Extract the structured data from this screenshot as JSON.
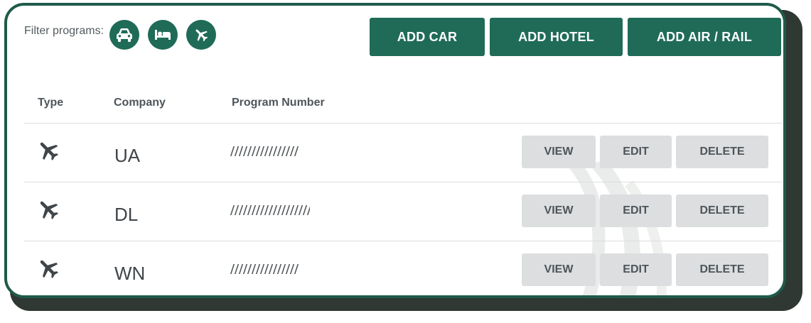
{
  "filter": {
    "label": "Filter programs:",
    "buttons": [
      {
        "icon": "car-icon",
        "name": "filter-car-button"
      },
      {
        "icon": "bed-icon",
        "name": "filter-hotel-button"
      },
      {
        "icon": "plane-icon",
        "name": "filter-air-button"
      }
    ]
  },
  "actions": {
    "add_car": "ADD CAR",
    "add_hotel": "ADD HOTEL",
    "add_air_rail": "ADD AIR / RAIL"
  },
  "table": {
    "headers": {
      "type": "Type",
      "company": "Company",
      "program_number": "Program Number"
    },
    "rows": [
      {
        "type_icon": "plane-icon",
        "company": "UA",
        "view": "VIEW",
        "edit": "EDIT",
        "delete": "DELETE"
      },
      {
        "type_icon": "plane-icon",
        "company": "DL",
        "view": "VIEW",
        "edit": "EDIT",
        "delete": "DELETE"
      },
      {
        "type_icon": "plane-icon",
        "company": "WN",
        "view": "VIEW",
        "edit": "EDIT",
        "delete": "DELETE"
      }
    ]
  },
  "colors": {
    "primary": "#1f6b58",
    "border": "#1f5a4a",
    "secondary_button": "#dcdedf",
    "text": "#4e555a"
  }
}
